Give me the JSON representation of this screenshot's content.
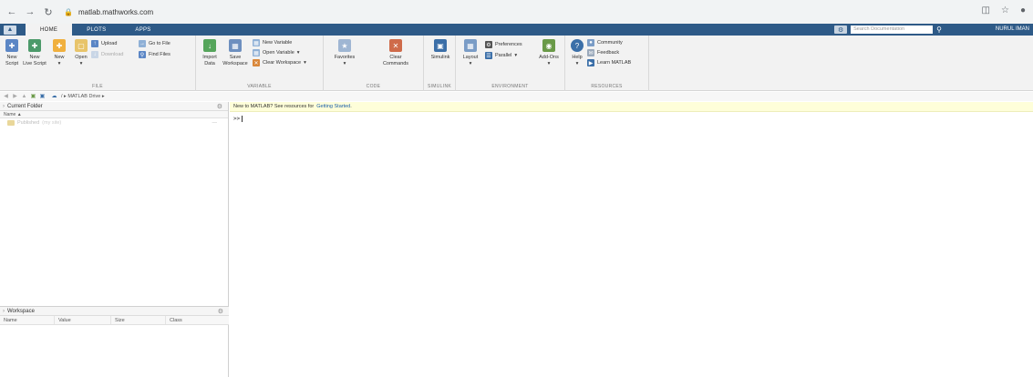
{
  "browser": {
    "url": "matlab.mathworks.com"
  },
  "tabs": [
    {
      "label": "HOME",
      "active": true
    },
    {
      "label": "PLOTS",
      "active": false
    },
    {
      "label": "APPS",
      "active": false
    }
  ],
  "search": {
    "placeholder": "Search Documentation"
  },
  "user": {
    "name": "NURUL IMAN"
  },
  "ribbon": {
    "file": {
      "label": "FILE",
      "new_script": [
        "New",
        "Script"
      ],
      "new_live_script": [
        "New",
        "Live Script"
      ],
      "new": [
        "New",
        ""
      ],
      "open": [
        "Open",
        ""
      ],
      "upload": "Upload",
      "download": "Download",
      "go_to_file": "Go to File",
      "find_files": "Find Files"
    },
    "variable": {
      "label": "VARIABLE",
      "import_data": [
        "Import",
        "Data"
      ],
      "save_workspace": [
        "Save",
        "Workspace"
      ],
      "new_variable": "New Variable",
      "open_variable": "Open Variable",
      "clear_workspace": "Clear Workspace"
    },
    "code": {
      "label": "CODE",
      "favorites": [
        "Favorites",
        ""
      ],
      "clear_commands": [
        "Clear",
        "Commands"
      ]
    },
    "simulink": {
      "label": "SIMULINK",
      "simulink": "Simulink"
    },
    "environment": {
      "label": "ENVIRONMENT",
      "layout": "Layout",
      "preferences": "Preferences",
      "parallel": "Parallel",
      "add_ons": "Add-Ons"
    },
    "resources": {
      "label": "RESOURCES",
      "help": "Help",
      "community": "Community",
      "feedback": "Feedback",
      "learn_matlab": "Learn MATLAB"
    }
  },
  "address": {
    "path": "/ ▸ MATLAB Drive ▸"
  },
  "current_folder": {
    "title": "Current Folder",
    "column_name": "Name ▲",
    "items": [
      {
        "name": "Published",
        "note": "(my site)"
      }
    ]
  },
  "workspace": {
    "title": "Workspace",
    "columns": [
      "Name",
      "Value",
      "Size",
      "Class"
    ]
  },
  "command_window": {
    "banner_text": "New to MATLAB? See resources for",
    "banner_link": "Getting Started",
    "banner_end": ".",
    "prompt": ">>"
  },
  "colors": {
    "tabstrip": "#2e5a87",
    "ribbon": "#f2f2f2",
    "banner": "#fefed9",
    "link": "#1a5ea8"
  }
}
